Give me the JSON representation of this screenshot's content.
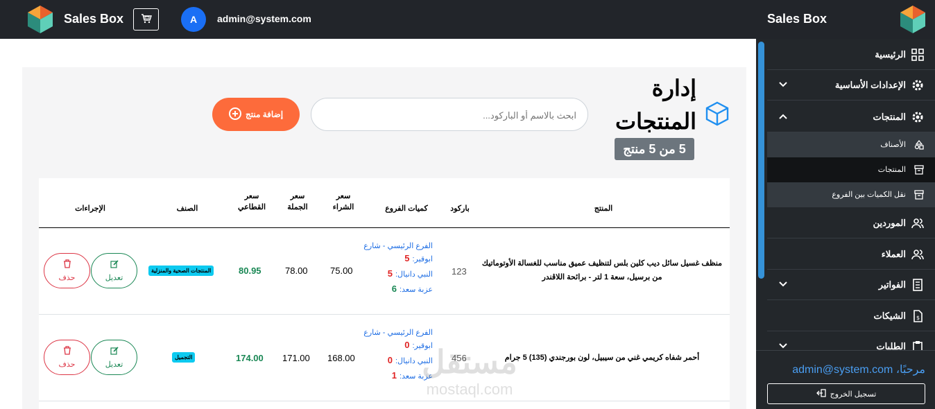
{
  "topbar": {
    "brand": "Sales Box",
    "user_initial": "A",
    "user_email": "admin@system.com"
  },
  "sidebar": {
    "brand": "Sales Box",
    "items": [
      {
        "label": "الرئيسية",
        "icon": "dashboard-icon"
      },
      {
        "label": "الإعدادات الأساسية",
        "icon": "gear-icon",
        "chevron": "down"
      },
      {
        "label": "المنتجات",
        "icon": "gear-icon",
        "chevron": "up"
      },
      {
        "label": "الموردين",
        "icon": "users-icon"
      },
      {
        "label": "العملاء",
        "icon": "users-icon"
      },
      {
        "label": "الفواتير",
        "icon": "invoice-icon",
        "chevron": "down"
      },
      {
        "label": "الشيكات",
        "icon": "check-document-icon"
      },
      {
        "label": "الطلبات",
        "icon": "clipboard-icon",
        "chevron": "down"
      }
    ],
    "sub_items": [
      {
        "label": "الأصناف",
        "icon": "shapes-icon"
      },
      {
        "label": "المنتجات",
        "icon": "archive-icon"
      },
      {
        "label": "نقل الكميات بين الفروع",
        "icon": "archive-icon"
      }
    ],
    "greeting": "مرحبًا، admin@system.com",
    "logout_label": "تسجيل الخروج"
  },
  "main": {
    "title": "إدارة المنتجات",
    "count_badge": "5 من 5 منتج",
    "search_placeholder": "ابحث بالاسم أو الباركود...",
    "add_button": "إضافة منتج"
  },
  "table": {
    "headers": {
      "product": "المنتج",
      "barcode": "باركود",
      "branch_qty": "كميات الفروع",
      "purchase_price": "سعر الشراء",
      "wholesale_price": "سعر الجملة",
      "retail_price": "سعر القطاعي",
      "category": "الصنف",
      "actions": "الإجراءات"
    },
    "rows": [
      {
        "product": "منظف غسيل سائل ديب كلين بلس لتنظيف عميق مناسب للغسالة الأوتوماتيك من برسيل، سعة 1 لتر - برائحة اللاڤندر",
        "barcode": "123",
        "branches": [
          {
            "name": "الفرع الرئيسي - شارع ابوقير:",
            "qty": "5"
          },
          {
            "name": "النبي دانيال:",
            "qty": "5"
          },
          {
            "name": "عزبة سعد:",
            "qty": "6"
          }
        ],
        "purchase": "75.00",
        "wholesale": "78.00",
        "retail": "80.95",
        "category": "المنتجات الصحية والمنزلية"
      },
      {
        "product": "أحمر شفاه كريمي غني من سيبيل، لون بورجندي (135) 5 جرام",
        "barcode": "456",
        "branches": [
          {
            "name": "الفرع الرئيسي - شارع ابوقير:",
            "qty": "0"
          },
          {
            "name": "النبي دانيال:",
            "qty": "0"
          },
          {
            "name": "عزبة سعد:",
            "qty": "1"
          }
        ],
        "purchase": "168.00",
        "wholesale": "171.00",
        "retail": "174.00",
        "category": "التجميل"
      }
    ],
    "edit_label": "تعديل",
    "delete_label": "حذف"
  },
  "watermark": {
    "arabic": "مستقل",
    "latin": "mostaql.com"
  },
  "colors": {
    "topbar_bg": "#22252a",
    "sidebar_bg": "#23272b",
    "accent_blue": "#1f8ff0",
    "add_button": "#fd6b3b",
    "badge_gray": "#6c757d",
    "category_badge": "#0dcaf0",
    "edit_green": "#198754",
    "delete_red": "#dc3545"
  }
}
